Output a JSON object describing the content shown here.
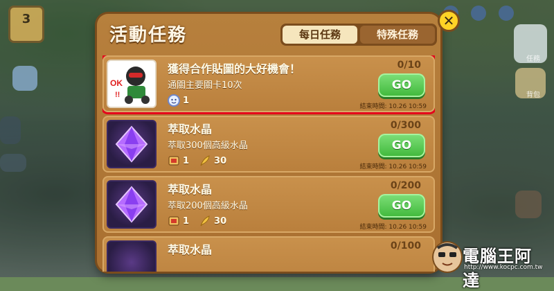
{
  "background": {
    "level_label": "",
    "level_value": "3",
    "right_labels": [
      "任務",
      "背包"
    ]
  },
  "panel": {
    "title": "活動任務",
    "tabs": [
      {
        "label": "每日任務",
        "active": true
      },
      {
        "label": "特殊任務",
        "active": false
      }
    ],
    "close_label": "✕"
  },
  "missions": [
    {
      "title": "獲得合作貼圖的大好機會！",
      "description": "通關主要關卡10次",
      "progress": "0/10",
      "go_label": "GO",
      "deadline": "結束時間: 10.26 10:59",
      "thumbnail": "sticker-icon",
      "rewards": [
        {
          "icon": "coin-face-icon",
          "amount": "1"
        }
      ],
      "highlighted": true
    },
    {
      "title": "萃取水晶",
      "description": "萃取300個高級水晶",
      "progress": "0/300",
      "go_label": "GO",
      "deadline": "結束時間: 10.26 10:59",
      "thumbnail": "purple-crystal-icon",
      "rewards": [
        {
          "icon": "treasure-card-icon",
          "amount": "1"
        },
        {
          "icon": "feather-icon",
          "amount": "30"
        }
      ],
      "highlighted": false
    },
    {
      "title": "萃取水晶",
      "description": "萃取200個高級水晶",
      "progress": "0/200",
      "go_label": "GO",
      "deadline": "結束時間: 10.26 10:59",
      "thumbnail": "purple-crystal-icon",
      "rewards": [
        {
          "icon": "treasure-card-icon",
          "amount": "1"
        },
        {
          "icon": "feather-icon",
          "amount": "30"
        }
      ],
      "highlighted": false
    },
    {
      "title": "萃取水晶",
      "description": "",
      "progress": "0/100",
      "go_label": "",
      "deadline": "",
      "thumbnail": "purple-crystal-icon",
      "rewards": [],
      "highlighted": false
    }
  ],
  "watermark": {
    "title": "電腦王阿達",
    "url": "http://www.kocpc.com.tw"
  },
  "colors": {
    "panel_wood": "#b7803d",
    "go_green": "#3fb83a",
    "highlight_red": "#e5001b",
    "close_yellow": "#ffd326"
  }
}
